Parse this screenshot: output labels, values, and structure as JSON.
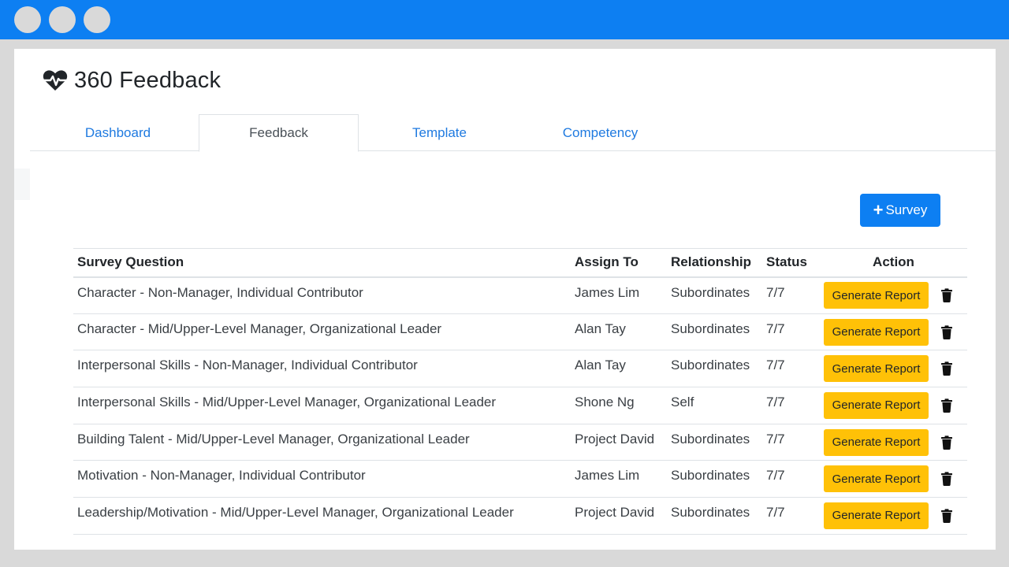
{
  "app": {
    "title": "360 Feedback",
    "icon": "heartbeat-icon"
  },
  "tabs": [
    {
      "label": "Dashboard",
      "active": false
    },
    {
      "label": "Feedback",
      "active": true
    },
    {
      "label": "Template",
      "active": false
    },
    {
      "label": "Competency",
      "active": false
    }
  ],
  "toolbar": {
    "add_survey_label": "Survey",
    "add_survey_icon": "plus-icon"
  },
  "table": {
    "headers": {
      "question": "Survey Question",
      "assign_to": "Assign To",
      "relationship": "Relationship",
      "status": "Status",
      "action": "Action"
    },
    "rows": [
      {
        "question": "Character - Non-Manager, Individual Contributor",
        "assign_to": "James Lim",
        "relationship": "Subordinates",
        "status": "7/7",
        "action_label": "Generate Report"
      },
      {
        "question": "Character - Mid/Upper-Level Manager, Organizational Leader",
        "assign_to": "Alan Tay",
        "relationship": "Subordinates",
        "status": "7/7",
        "action_label": "Generate Report"
      },
      {
        "question": "Interpersonal Skills - Non-Manager, Individual Contributor",
        "assign_to": "Alan Tay",
        "relationship": "Subordinates",
        "status": "7/7",
        "action_label": "Generate Report"
      },
      {
        "question": "Interpersonal Skills - Mid/Upper-Level Manager, Organizational Leader",
        "assign_to": "Shone Ng",
        "relationship": "Self",
        "status": "7/7",
        "action_label": "Generate Report"
      },
      {
        "question": "Building Talent - Mid/Upper-Level Manager, Organizational Leader",
        "assign_to": "Project David",
        "relationship": "Subordinates",
        "status": "7/7",
        "action_label": "Generate Report"
      },
      {
        "question": "Motivation - Non-Manager, Individual Contributor",
        "assign_to": "James Lim",
        "relationship": "Subordinates",
        "status": "7/7",
        "action_label": "Generate Report"
      },
      {
        "question": "Leadership/Motivation - Mid/Upper-Level Manager, Organizational Leader",
        "assign_to": "Project David",
        "relationship": "Subordinates",
        "status": "7/7",
        "action_label": "Generate Report"
      }
    ]
  },
  "colors": {
    "titlebar": "#0d7ff2",
    "primary": "#0d7ff2",
    "warning": "#ffc107",
    "link": "#1f7ae0"
  }
}
